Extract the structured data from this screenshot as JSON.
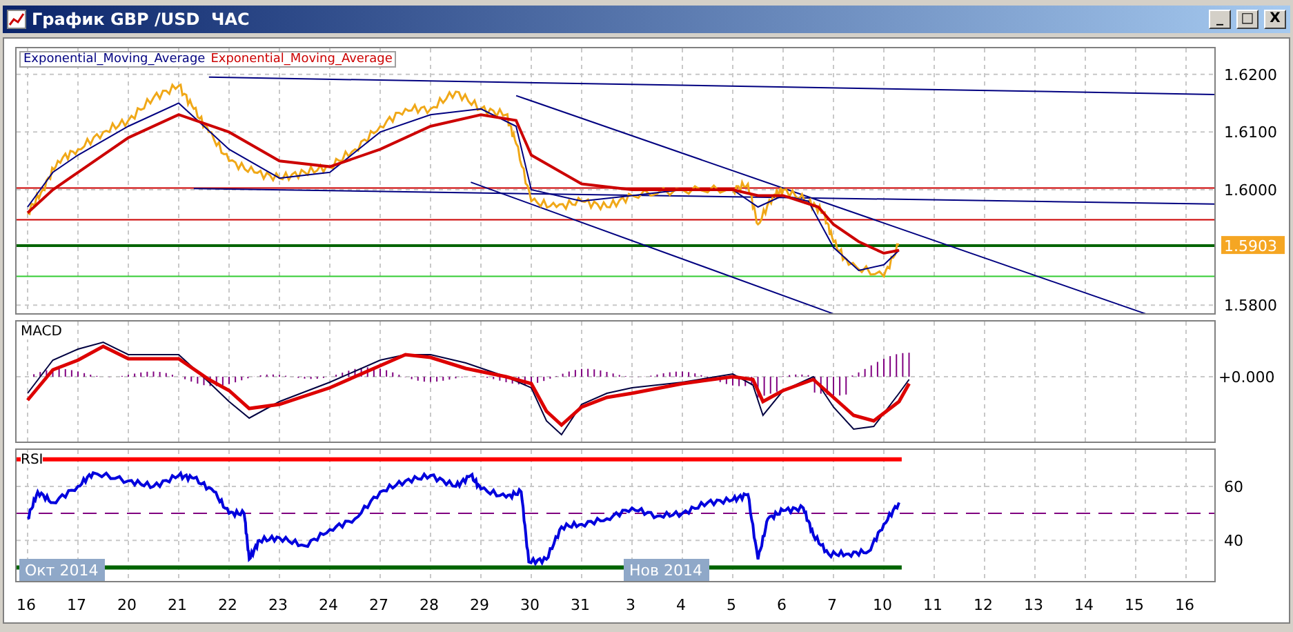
{
  "window": {
    "title": "График GBP /USD  ЧАС",
    "controls": [
      "_",
      "□",
      "X"
    ]
  },
  "price_chart": {
    "legend": [
      {
        "label": "Exponential_Moving_Average",
        "color": "#000080"
      },
      {
        "label": "Exponential_Moving_Average",
        "color": "#cc0000"
      }
    ],
    "y_labels": [
      "1.6200",
      "1.6100",
      "1.6000",
      "1.5800"
    ],
    "current_price": "1.5903"
  },
  "macd": {
    "title": "MACD",
    "y_label": "+0.000"
  },
  "rsi": {
    "title": "RSI",
    "y_labels": [
      "60",
      "40"
    ]
  },
  "x_axis": {
    "labels": [
      "16",
      "17",
      "20",
      "21",
      "22",
      "23",
      "24",
      "27",
      "28",
      "29",
      "30",
      "31",
      "3",
      "4",
      "5",
      "6",
      "7",
      "10",
      "11",
      "12",
      "13",
      "14",
      "15",
      "16"
    ],
    "month_labels": [
      "Окт 2014",
      "Нов 2014"
    ]
  }
}
